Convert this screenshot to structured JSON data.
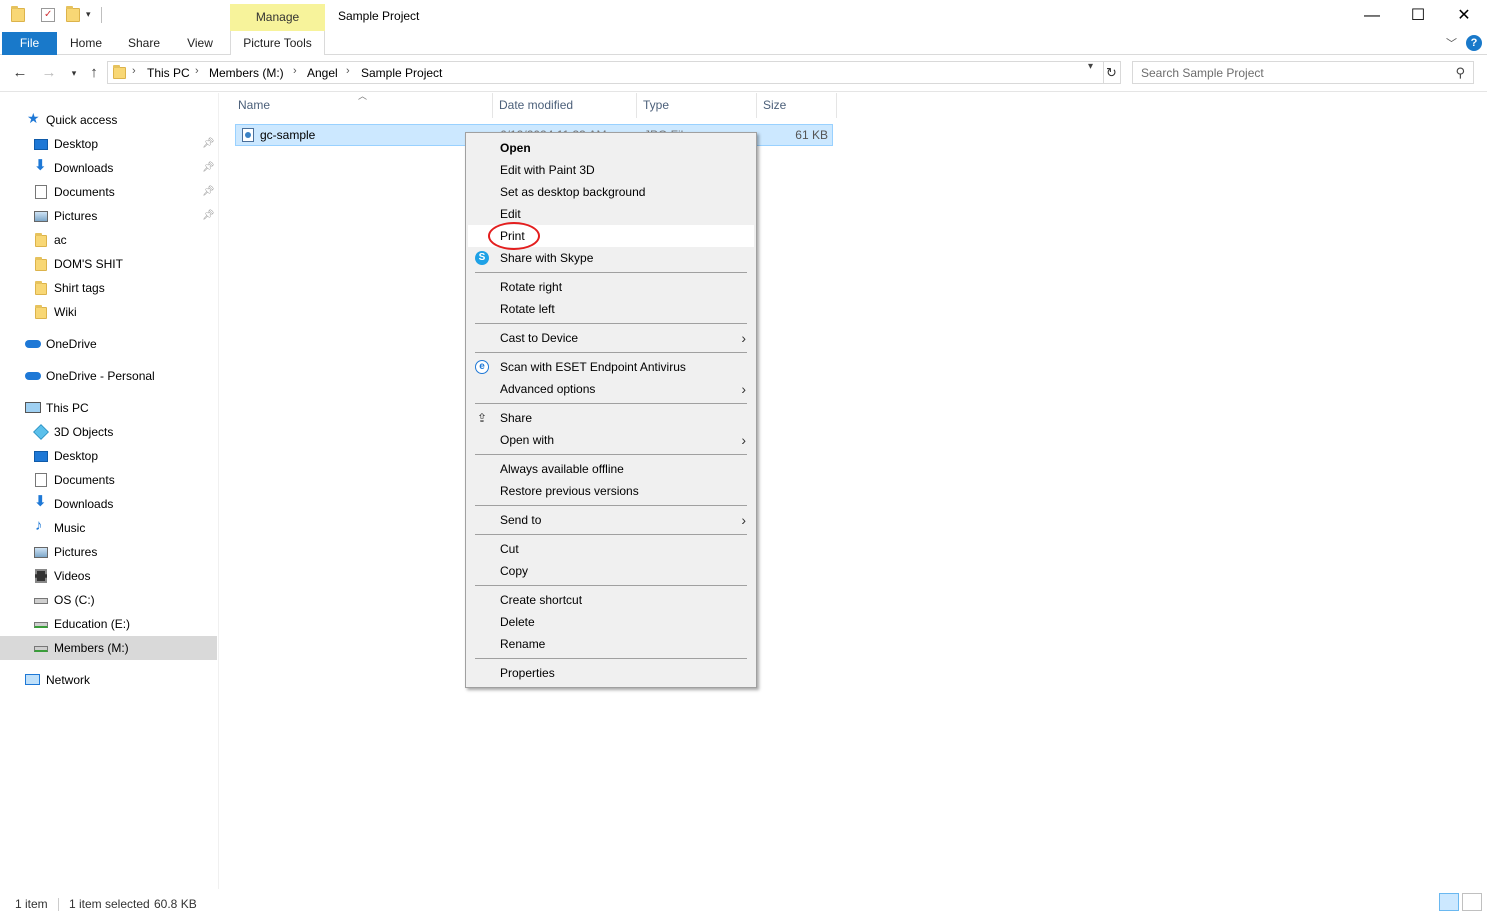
{
  "window": {
    "title": "Sample Project",
    "manage_tab": "Manage",
    "controls": {
      "minimize": "—",
      "maximize": "☐",
      "close": "✕"
    }
  },
  "ribbon": {
    "file": "File",
    "tabs": [
      "Home",
      "Share",
      "View"
    ],
    "picture_tools": "Picture Tools",
    "help": "?"
  },
  "address": {
    "crumbs": [
      "This PC",
      "Members (M:)",
      "Angel",
      "Sample Project"
    ],
    "search_placeholder": "Search Sample Project"
  },
  "sidebar": {
    "quick_access": "Quick access",
    "quick_items": [
      "Desktop",
      "Downloads",
      "Documents",
      "Pictures",
      "ac",
      "DOM'S SHIT",
      "Shirt tags",
      "Wiki"
    ],
    "onedrive": "OneDrive",
    "onedrive_personal": "OneDrive - Personal",
    "this_pc": "This PC",
    "pc_items": [
      "3D Objects",
      "Desktop",
      "Documents",
      "Downloads",
      "Music",
      "Pictures",
      "Videos",
      "OS (C:)",
      "Education (E:)",
      "Members (M:)"
    ],
    "network": "Network"
  },
  "columns": {
    "name": "Name",
    "date": "Date modified",
    "type": "Type",
    "size": "Size"
  },
  "file": {
    "name": "gc-sample",
    "date": "6/12/2024 11:33 AM",
    "type": "JPG File",
    "size": "61 KB"
  },
  "context_menu": {
    "open": "Open",
    "edit_paint3d": "Edit with Paint 3D",
    "set_desktop_bg": "Set as desktop background",
    "edit": "Edit",
    "print": "Print",
    "share_skype": "Share with Skype",
    "rotate_right": "Rotate right",
    "rotate_left": "Rotate left",
    "cast": "Cast to Device",
    "scan_eset": "Scan with ESET Endpoint Antivirus",
    "advanced": "Advanced options",
    "share": "Share",
    "open_with": "Open with",
    "always_offline": "Always available offline",
    "restore_versions": "Restore previous versions",
    "send_to": "Send to",
    "cut": "Cut",
    "copy": "Copy",
    "create_shortcut": "Create shortcut",
    "delete": "Delete",
    "rename": "Rename",
    "properties": "Properties"
  },
  "status": {
    "count": "1 item",
    "selected": "1 item selected",
    "size": "60.8 KB"
  }
}
